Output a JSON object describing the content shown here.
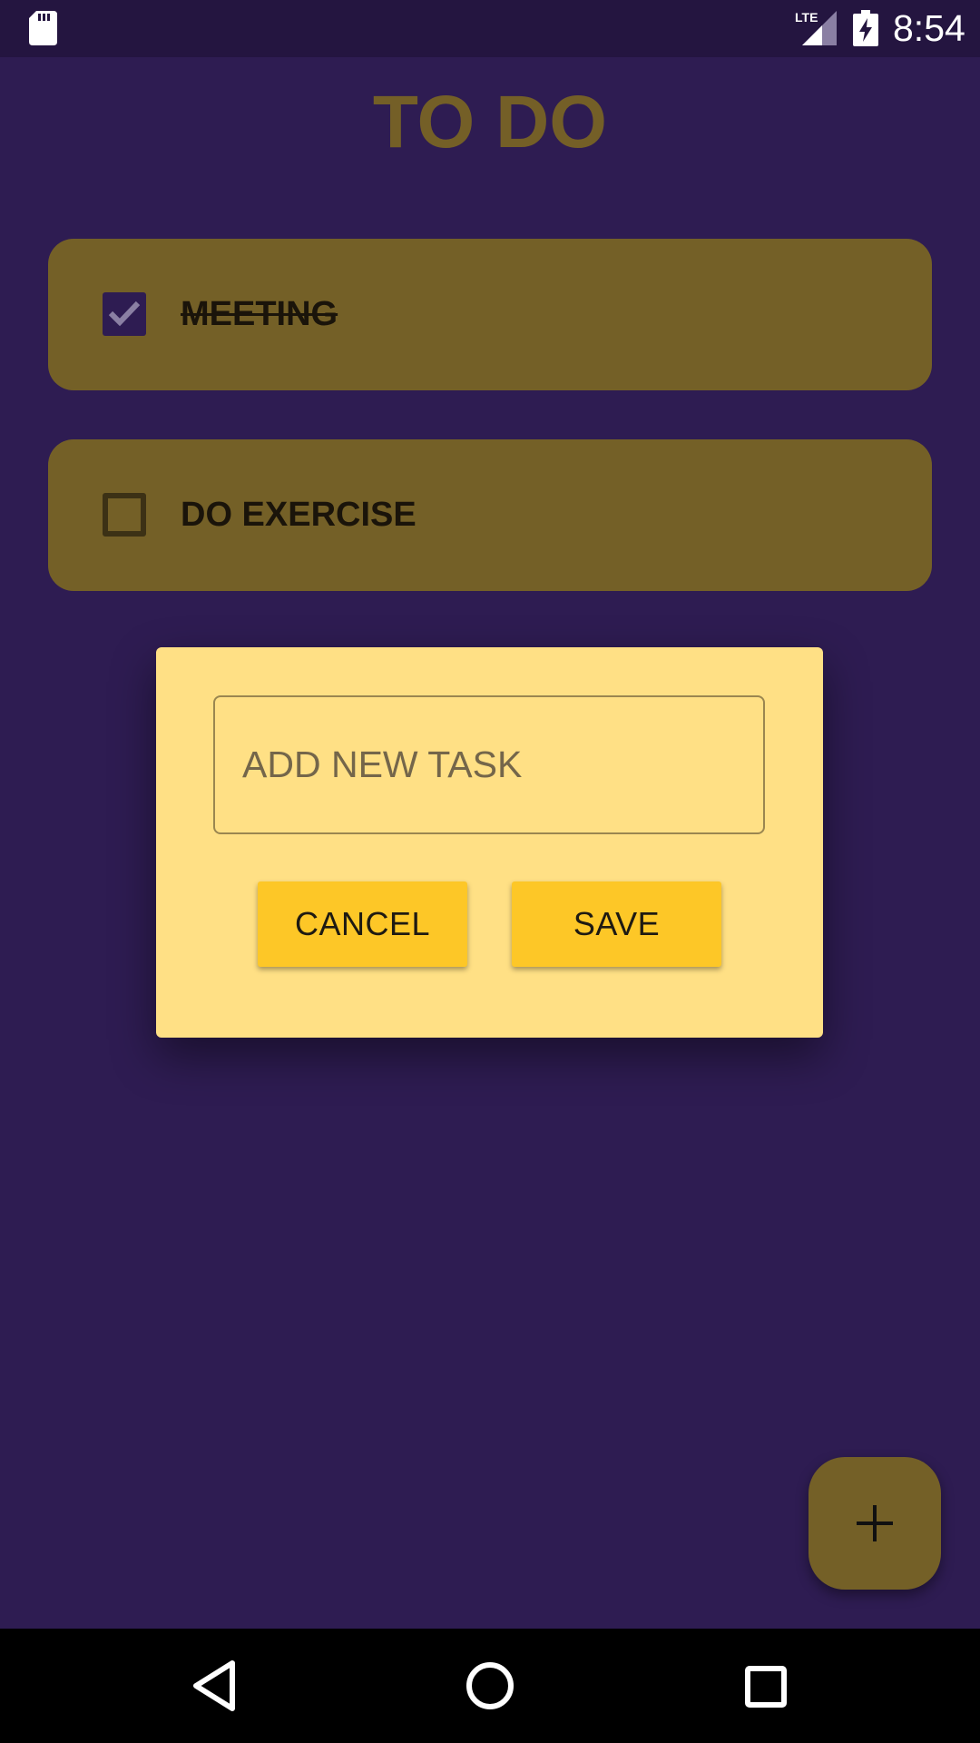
{
  "status_bar": {
    "time": "8:54",
    "network": "LTE",
    "icons": [
      "sd-card-icon",
      "lte-signal-icon",
      "battery-charging-icon"
    ]
  },
  "page": {
    "title": "TO DO"
  },
  "tasks": [
    {
      "label": "MEETING",
      "checked": true
    },
    {
      "label": "DO EXERCISE",
      "checked": false
    }
  ],
  "dialog": {
    "input_placeholder": "ADD NEW TASK",
    "input_value": "",
    "cancel_label": "CANCEL",
    "save_label": "SAVE"
  },
  "fab": {
    "icon": "plus-icon"
  },
  "nav_bar": {
    "icons": [
      "back-icon",
      "home-icon",
      "recents-icon"
    ]
  },
  "colors": {
    "background": "#2e1c52",
    "accent": "#746027",
    "title": "#745f27",
    "dialog": "#ffe085",
    "button": "#fdc727"
  }
}
